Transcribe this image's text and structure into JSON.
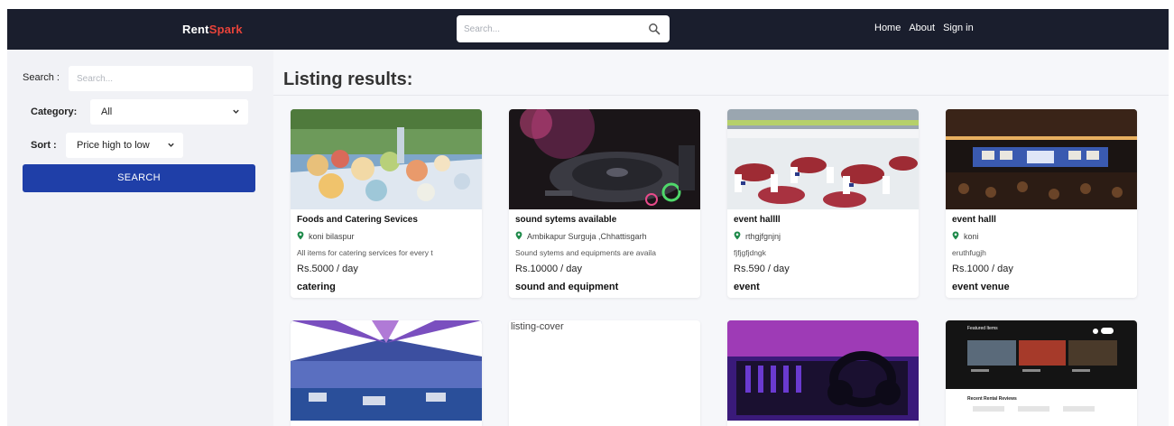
{
  "header": {
    "logo_main": "Rent",
    "logo_accent": "Spark",
    "search_placeholder": "Search...",
    "nav": [
      "Home",
      "About",
      "Sign in"
    ]
  },
  "sidebar": {
    "search_label": "Search :",
    "search_placeholder": "Search...",
    "category_label": "Category:",
    "category_value": "All",
    "sort_label": "Sort :",
    "sort_value": "Price high to low",
    "search_button": "SEARCH"
  },
  "main": {
    "title": "Listing results:",
    "listings": [
      {
        "title": "Foods and Catering Sevices",
        "location": "koni bilaspur",
        "description": "All items for catering services for every t",
        "price": "Rs.5000 / day",
        "category": "catering"
      },
      {
        "title": "sound sytems available",
        "location": "Ambikapur Surguja ,Chhattisgarh",
        "description": "Sound sytems and equipments are availa",
        "price": "Rs.10000 / day",
        "category": "sound and equipment"
      },
      {
        "title": "event hallll",
        "location": "rthgjfgnjnj",
        "description": "fjfjgfjdngk",
        "price": "Rs.590 / day",
        "category": "event"
      },
      {
        "title": "event halll",
        "location": "koni",
        "description": "eruthfugjh",
        "price": "Rs.1000 / day",
        "category": "event venue"
      }
    ],
    "second_row": {
      "broken_image_alt": "listing-cover"
    },
    "thumb5": {
      "featured_label": "Featured Items",
      "reviews_label": "Recent Rental Reviews"
    }
  },
  "colors": {
    "navbar": "#1a1e2d",
    "logo_accent": "#e8433a",
    "primary_button": "#1f3fa8",
    "location_pin": "#1e8a4a"
  }
}
